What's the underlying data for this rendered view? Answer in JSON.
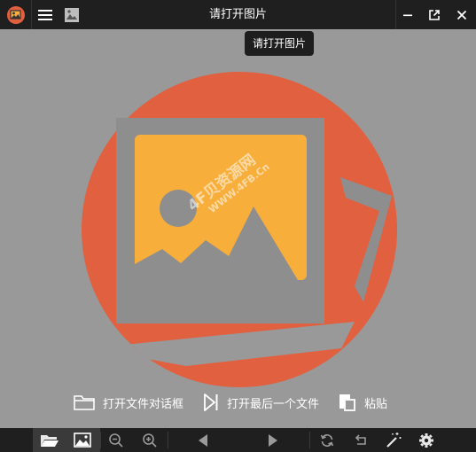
{
  "window": {
    "title": "请打开图片",
    "tooltip": "请打开图片"
  },
  "actions": [
    {
      "label": "打开文件对话框",
      "icon": "folder-icon"
    },
    {
      "label": "打开最后一个文件",
      "icon": "last-file-icon"
    },
    {
      "label": "粘贴",
      "icon": "paste-icon"
    }
  ],
  "watermark": {
    "logo_text": "4F贝资源网",
    "url": "WWW.4FB.Cn"
  },
  "colors": {
    "titlebar": "#1f1f1f",
    "background": "#999999",
    "circle": "#e0603f",
    "photo": "#f8ae3b",
    "frame": "#8e8e8e"
  }
}
